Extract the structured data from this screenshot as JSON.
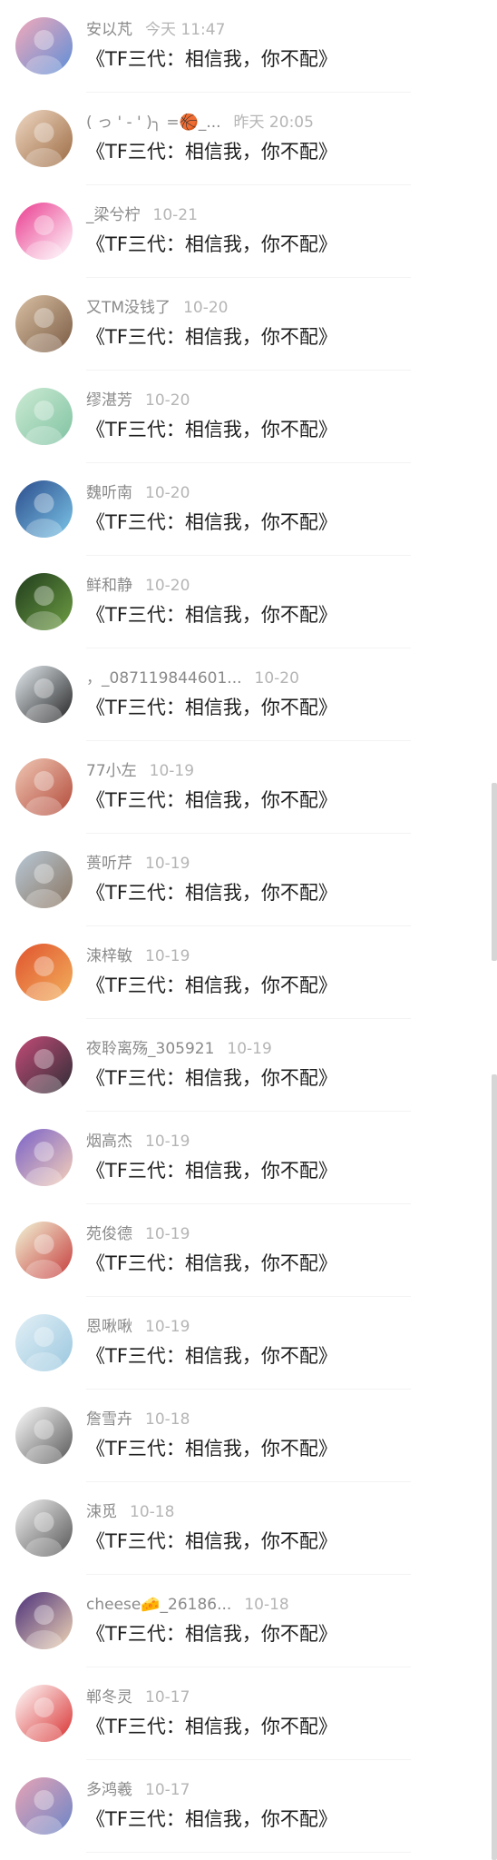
{
  "message": "《TF三代：相信我，你不配》",
  "comments": [
    {
      "name": "安以芃",
      "time": "今天 11:47",
      "avatar_colors": [
        "#f4a9b9",
        "#5d8fd8"
      ],
      "avatar_icon": "girl-photo-avatar"
    },
    {
      "name": "( っ ' - ' )╮ =🏀_...",
      "time": "昨天 20:05",
      "avatar_colors": [
        "#efd8c3",
        "#9c6b43"
      ],
      "avatar_icon": "child-photo-avatar"
    },
    {
      "name": "_梁兮柠",
      "time": "10-21",
      "avatar_colors": [
        "#ea3b8f",
        "#ffffff"
      ],
      "avatar_icon": "hello-kitty-avatar"
    },
    {
      "name": "又TM没钱了",
      "time": "10-20",
      "avatar_colors": [
        "#d9c0a4",
        "#7a5b43"
      ],
      "avatar_icon": "laughing-child-avatar"
    },
    {
      "name": "缪湛芳",
      "time": "10-20",
      "avatar_colors": [
        "#cdebd5",
        "#7fc2a1"
      ],
      "avatar_icon": "green-scene-avatar"
    },
    {
      "name": "魏听南",
      "time": "10-20",
      "avatar_colors": [
        "#2b4c8c",
        "#7cc6e8"
      ],
      "avatar_icon": "blue-fantasy-avatar"
    },
    {
      "name": "鲜和静",
      "time": "10-20",
      "avatar_colors": [
        "#1f3b1c",
        "#6f9f44"
      ],
      "avatar_icon": "vintage-car-avatar"
    },
    {
      "name": "，_087119844601...",
      "time": "10-20",
      "avatar_colors": [
        "#e5ecf1",
        "#222222"
      ],
      "avatar_icon": "anime-girl-avatar"
    },
    {
      "name": "77小左",
      "time": "10-19",
      "avatar_colors": [
        "#f0c8b5",
        "#b34a3a"
      ],
      "avatar_icon": "eating-girl-avatar"
    },
    {
      "name": "蒉听芹",
      "time": "10-19",
      "avatar_colors": [
        "#b8c9d8",
        "#8a7560"
      ],
      "avatar_icon": "cat-avatar"
    },
    {
      "name": "涑梓敏",
      "time": "10-19",
      "avatar_colors": [
        "#e0532f",
        "#f2b15c"
      ],
      "avatar_icon": "food-plate-avatar"
    },
    {
      "name": "夜聆离殇_305921",
      "time": "10-19",
      "avatar_colors": [
        "#c44b78",
        "#2e2e36"
      ],
      "avatar_icon": "flower-girl-avatar"
    },
    {
      "name": "烟高杰",
      "time": "10-19",
      "avatar_colors": [
        "#7a62c9",
        "#f5d0b8"
      ],
      "avatar_icon": "purple-anime-avatar"
    },
    {
      "name": "苑俊德",
      "time": "10-19",
      "avatar_colors": [
        "#f2f6d8",
        "#c63b3b"
      ],
      "avatar_icon": "schoolgirl-drawing-avatar"
    },
    {
      "name": "恩啾啾",
      "time": "10-19",
      "avatar_colors": [
        "#e3f0f6",
        "#9ac7df"
      ],
      "avatar_icon": "white-hair-anime-avatar"
    },
    {
      "name": "詹雪卉",
      "time": "10-18",
      "avatar_colors": [
        "#ffffff",
        "#555555"
      ],
      "avatar_icon": "cartoon-cat-face-avatar"
    },
    {
      "name": "涑觅",
      "time": "10-18",
      "avatar_colors": [
        "#f2f2f2",
        "#555555"
      ],
      "avatar_icon": "bw-portrait-avatar"
    },
    {
      "name": "cheese🧀_26186...",
      "time": "10-18",
      "avatar_colors": [
        "#4a2f7a",
        "#f0d6b5"
      ],
      "avatar_icon": "man-in-jacket-avatar"
    },
    {
      "name": "郸冬灵",
      "time": "10-17",
      "avatar_colors": [
        "#ffffff",
        "#d93030"
      ],
      "avatar_icon": "maruko-avatar"
    },
    {
      "name": "多鸿羲",
      "time": "10-17",
      "avatar_colors": [
        "#e8a3b5",
        "#6b86c7"
      ],
      "avatar_icon": "sunset-sea-avatar"
    }
  ]
}
